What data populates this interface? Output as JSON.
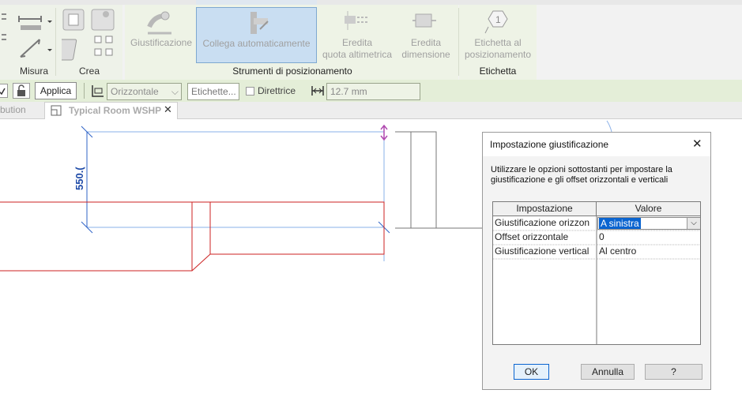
{
  "ribbon": {
    "groups": {
      "misura": "Misura",
      "crea": "Crea",
      "strumenti": "Strumenti di posizionamento",
      "etichetta": "Etichetta"
    },
    "buttons": {
      "giustificazione": "Giustificazione",
      "collega": "Collega automaticamente",
      "eredita_quota_1": "Eredita",
      "eredita_quota_2": "quota altimetrica",
      "eredita_dim_1": "Eredita",
      "eredita_dim_2": "dimensione",
      "etichetta_pos_1": "Etichetta al",
      "etichetta_pos_2": "posizionamento"
    }
  },
  "options_bar": {
    "applica": "Applica",
    "orientation": "Orizzontale",
    "etichette": "Etichette...",
    "direttrice": "Direttrice",
    "length": "12.7 mm"
  },
  "tabs": {
    "prev_partial": "bution",
    "active": "Typical Room WSHP"
  },
  "drawing": {
    "dimension": "550.("
  },
  "dialog": {
    "title": "Impostazione giustificazione",
    "description": "Utilizzare le opzioni sottostanti per impostare la giustificazione e gli offset orizzontali e verticali",
    "columns": [
      "Impostazione",
      "Valore"
    ],
    "rows": [
      {
        "setting": "Giustificazione orizzon",
        "value": "A sinistra"
      },
      {
        "setting": "Offset orizzontale",
        "value": "0"
      },
      {
        "setting": "Giustificazione vertical",
        "value": "Al centro"
      }
    ],
    "ok": "OK",
    "annulla": "Annulla",
    "help": "?"
  }
}
